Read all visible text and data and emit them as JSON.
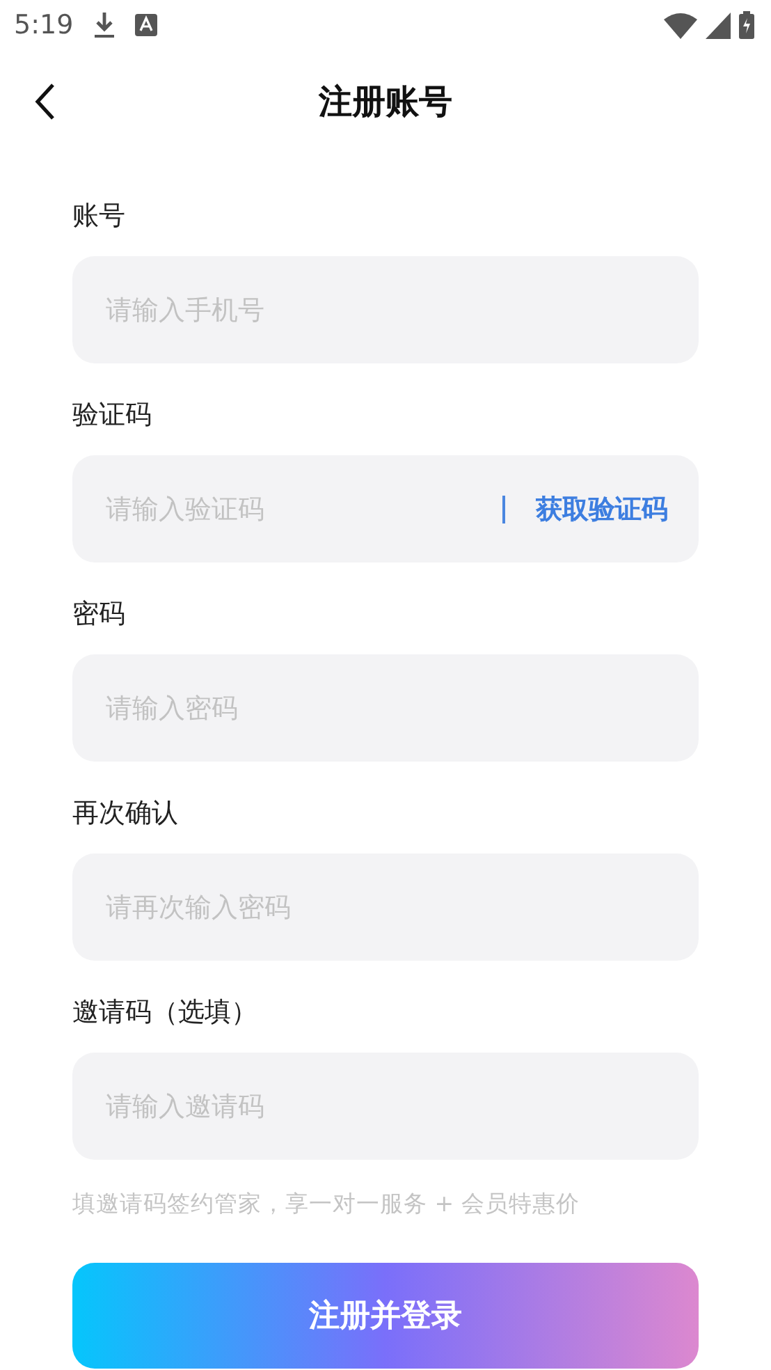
{
  "status_bar": {
    "time": "5:19"
  },
  "header": {
    "title": "注册账号"
  },
  "fields": [
    {
      "kind": "input",
      "label": "账号",
      "placeholder": "请输入手机号"
    },
    {
      "kind": "code",
      "label": "验证码",
      "placeholder": "请输入验证码",
      "action": "获取验证码"
    },
    {
      "kind": "input",
      "label": "密码",
      "placeholder": "请输入密码"
    },
    {
      "kind": "input",
      "label": "再次确认",
      "placeholder": "请再次输入密码"
    },
    {
      "kind": "input",
      "label": "邀请码（选填）",
      "placeholder": "请输入邀请码"
    }
  ],
  "hint": "填邀请码签约管家，享一对一服务 + 会员特惠价",
  "submit_button": "注册并登录"
}
